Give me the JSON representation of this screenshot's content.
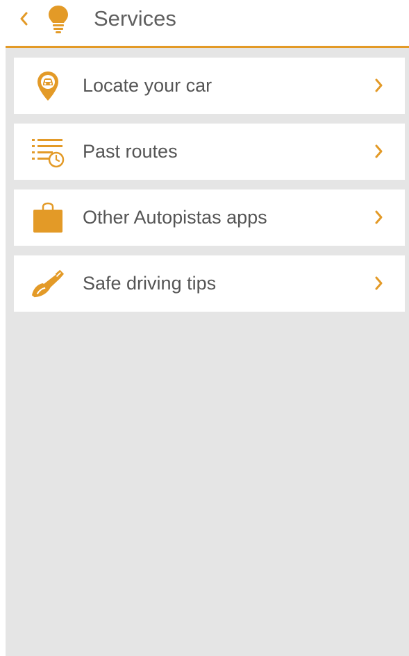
{
  "header": {
    "title": "Services",
    "back_icon": "chevron-left-icon",
    "app_icon": "lightbulb-icon"
  },
  "theme": {
    "accent": "#e39a27",
    "background": "#e5e5e5",
    "card": "#ffffff",
    "text": "#555555"
  },
  "menu": {
    "items": [
      {
        "label": "Locate your car",
        "icon": "car-location-pin-icon"
      },
      {
        "label": "Past routes",
        "icon": "route-history-icon"
      },
      {
        "label": "Other Autopistas apps",
        "icon": "shopping-bag-icon"
      },
      {
        "label": "Safe driving tips",
        "icon": "road-brush-icon"
      }
    ]
  }
}
